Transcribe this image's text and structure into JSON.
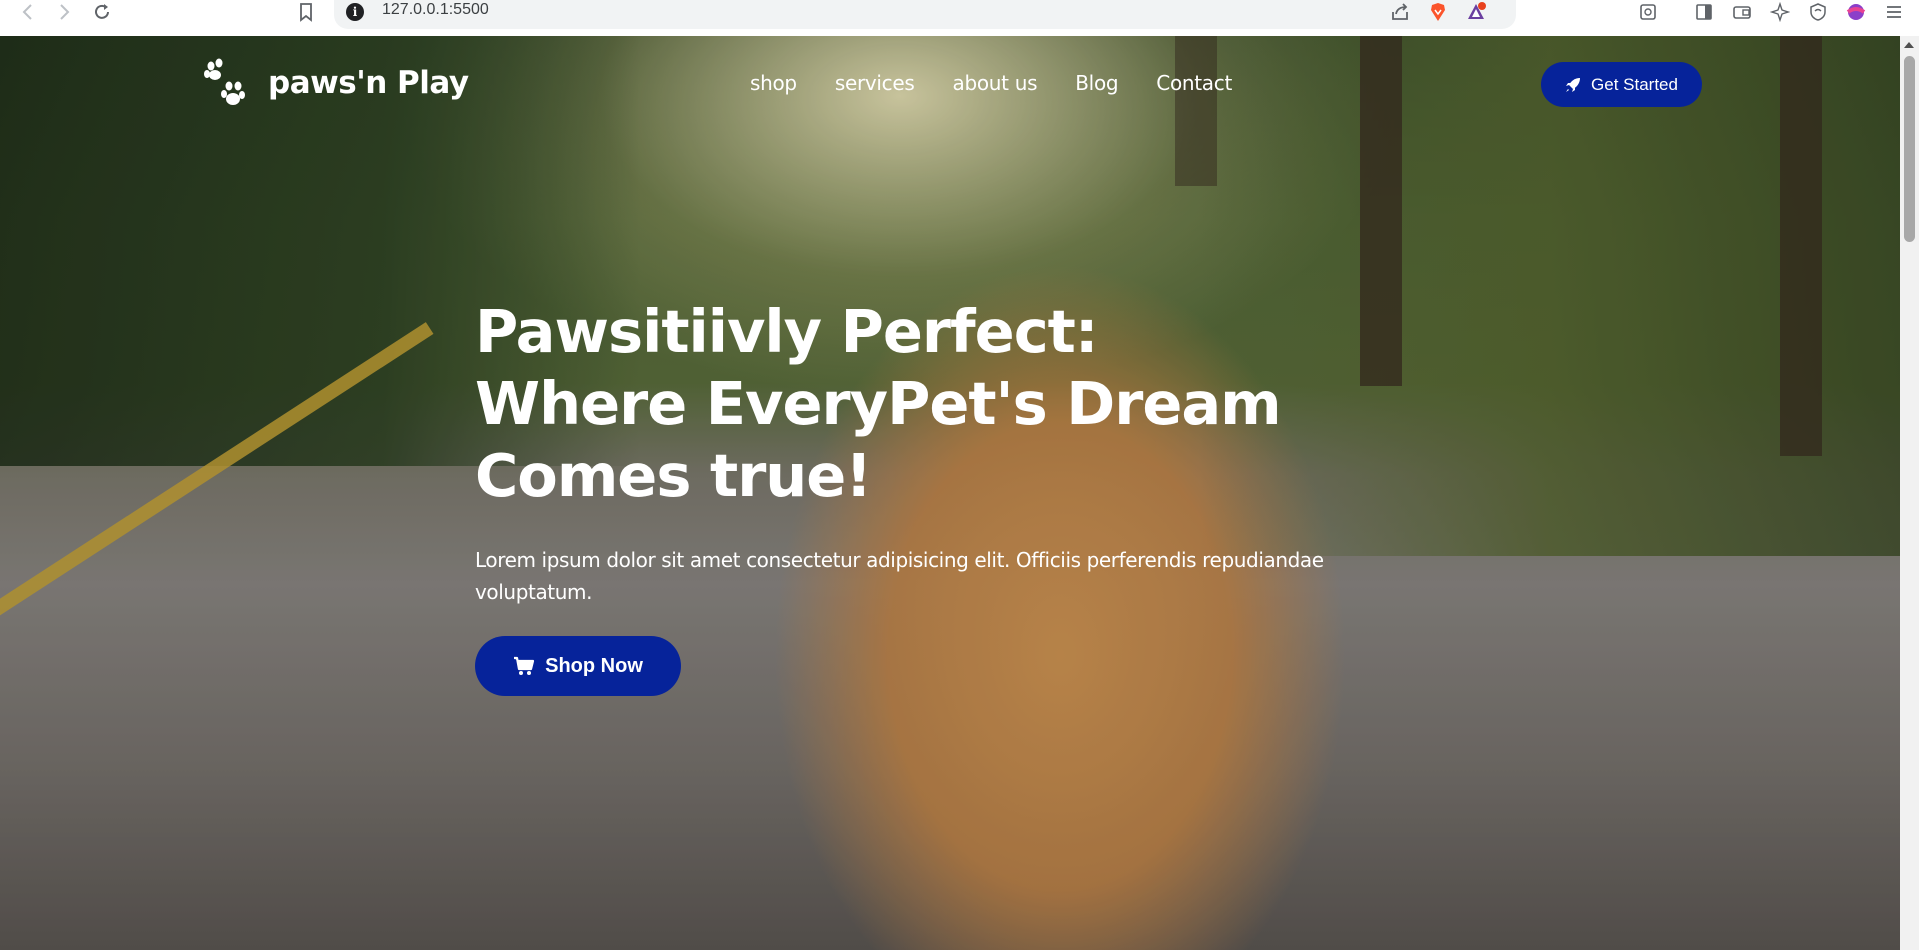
{
  "browser": {
    "url": "127.0.0.1:5500"
  },
  "site": {
    "logo_text": "paws'n Play",
    "nav": [
      "shop",
      "services",
      "about us",
      "Blog",
      "Contact"
    ],
    "cta_label": "Get Started"
  },
  "hero": {
    "title_lines": [
      "Pawsitiivly Perfect:",
      "Where EveryPet's Dream",
      "Comes true!"
    ],
    "subtitle": "Lorem ipsum dolor sit amet consectetur adipisicing elit. Officiis perferendis repudiandae voluptatum.",
    "button_label": "Shop Now"
  },
  "colors": {
    "accent": "#06239a",
    "text_light": "#ffffff"
  },
  "icons": {
    "logo": "paw-icon",
    "cta": "rocket-icon",
    "shop": "cart-icon"
  }
}
